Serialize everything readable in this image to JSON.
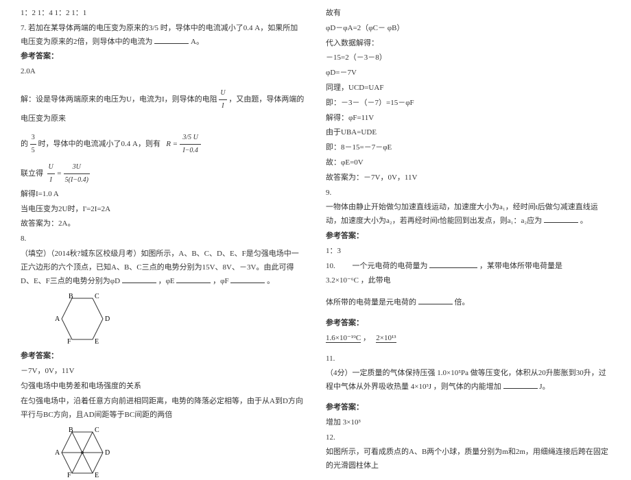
{
  "left": {
    "l0": "1：2  1：4  1：2  1：1",
    "q7": "7. 若加在某导体两端的电压变为原来的3/5 时，导体中的电流减小了0.4 A，如果所加电压变为原来的2倍，则导体中的电流为",
    "q7unit": "A。",
    "ans_label": "参考答案：",
    "a7_1": "2.0A",
    "a7_2a": "解：设是导体两端原来的电压为U，电流为I，则导体的电阻",
    "a7_2b": "，又由题，导体两端的电压变为原来",
    "a7_3a": "的",
    "a7_3b": "时，导体中的电流减小了0.4 A，则有",
    "a7_4": "联立得",
    "a7_5": "解得I=1.0 A",
    "a7_6": "当电压变为2U时，I'=2I=2A",
    "a7_7": "故答案为：2A。",
    "q8": "8.",
    "q8_1": "（填空）（2014秋?城东区校级月考）如图所示，A、B、C、D、E、F是匀强电场中一正六边形的六个顶点，已知A、B、C三点的电势分别为15V、8V、－3V。由此可得D、E、F三点的电势分别为φD",
    "q8_2a": "，φE",
    "q8_2b": "，φF",
    "q8_2c": "。",
    "a8_1": "－7V，0V，11V",
    "a8_2": "匀强电场中电势差和电场强度的关系",
    "a8_3": "在匀强电场中，沿着任意方向前进相同距离，电势的降落必定相等，由于从A到D方向平行与BC方向，且AD间距等于BC间距的两倍"
  },
  "right": {
    "r1": "故有",
    "r2": "φD－φA=2（φC－ φB）",
    "r3": "代入数据解得：",
    "r4": "－15=2（－3－8）",
    "r5": "φD=－7V",
    "r6": "同理，UCD=UAF",
    "r7": "即：－3－（－7）=15－φF",
    "r8": "解得：φF=11V",
    "r9": "由于UBA=UDE",
    "r10": "即：8－15=－7－φE",
    "r11": "故：φE=0V",
    "r12": "故答案为：－7V，0V，11V",
    "q9": "9.",
    "q9_1": "一物体由静止开始做匀加速直线运动，加速度大小为a₁，经时间t后做匀减速直线运动，加速度大小为a₂，若再经时间t恰能回到出发点，则a₁：a₂应为",
    "q9_2": "。",
    "a9_1": "1：3",
    "q10a": "10. 　　一个元电荷的电荷量为",
    "q10b": "，某带电体所带电荷量是",
    "q10c": "，此带电",
    "q10d": "体所带的电荷量是元电荷的",
    "q10e": "倍。",
    "q10val": "3.2×10⁻⁶C",
    "a10a": "1.6×10⁻¹⁹C",
    "a10sep": "，",
    "a10b": "2×10¹³",
    "q11": "11.",
    "q11_1a": "（4分）一定质量的气体保持压强",
    "q11_1val": "1.0×10⁵Pa",
    "q11_1b": "做等压变化，体积从20升膨胀到30升，过程中气体从外界吸收热量",
    "q11_1val2": "4×10³J",
    "q11_1c": "，则气体的内能增加",
    "q11_1d": "J。",
    "a11a": "增加",
    "a11b": "3×10³",
    "q12": "12.",
    "q12_1": "如图所示，可看成质点的A、B两个小球，质量分别为m和2m，用细绳连接后跨在固定的光滑圆柱体上"
  },
  "labels": {
    "A": "A",
    "B": "B",
    "C": "C",
    "D": "D",
    "E": "E",
    "F": "F"
  }
}
